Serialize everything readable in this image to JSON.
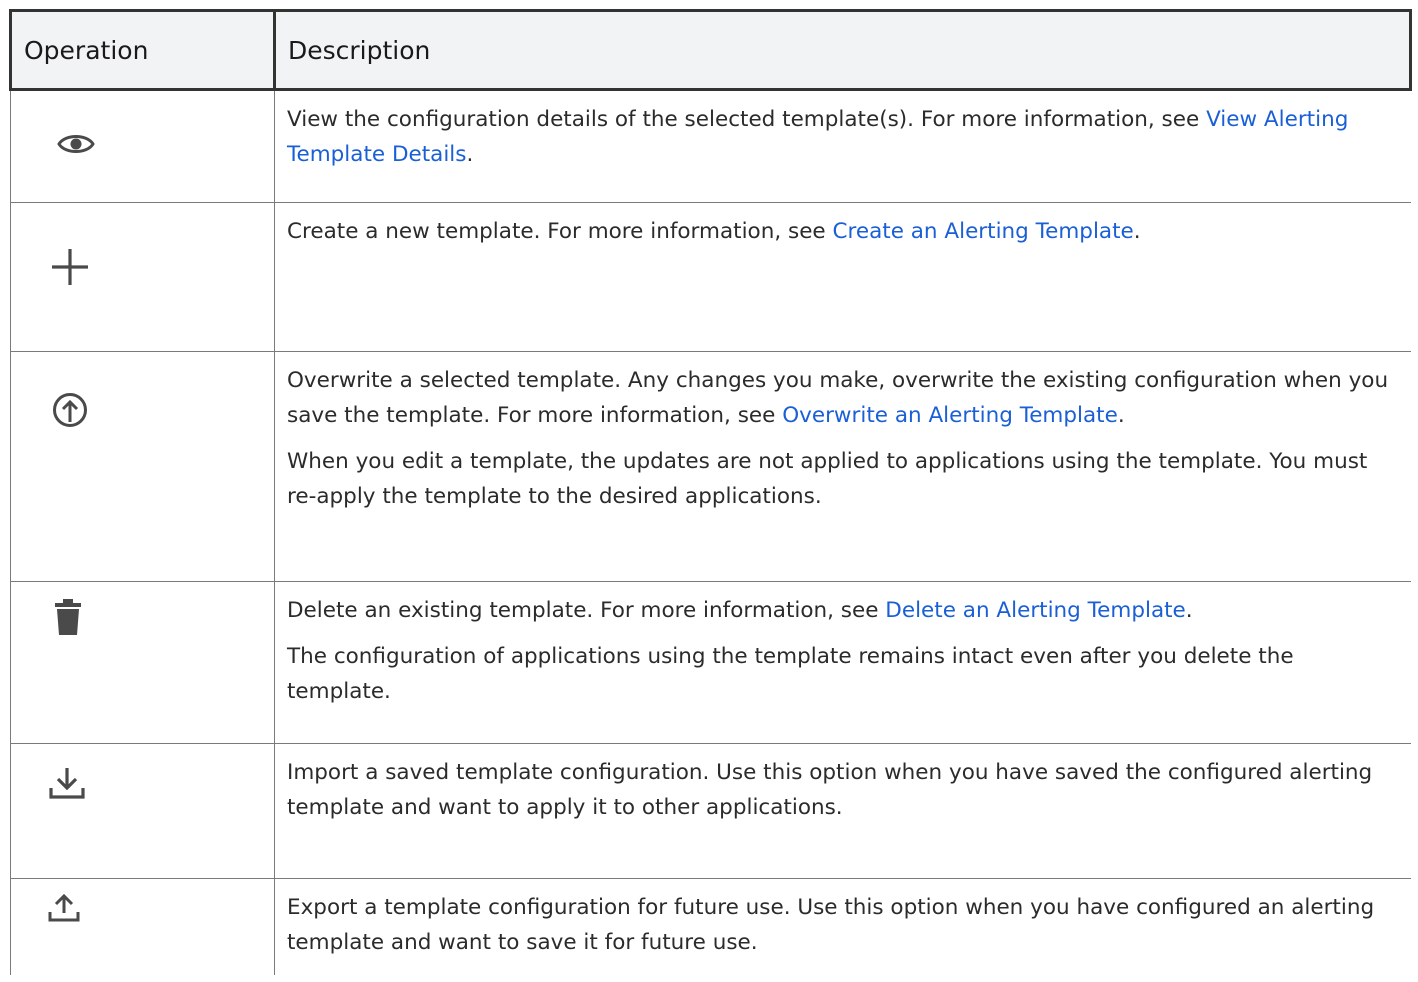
{
  "table": {
    "headers": {
      "operation": "Operation",
      "description": "Description"
    },
    "rows": [
      {
        "icon": "eye-icon",
        "paragraphs": [
          {
            "text": "View the configuration details of the selected template(s). For more information, see ",
            "link": "View Alerting Template Details",
            "after": "."
          }
        ]
      },
      {
        "icon": "plus-icon",
        "paragraphs": [
          {
            "text": "Create a new template. For more information, see ",
            "link": "Create an Alerting Template",
            "after": "."
          }
        ]
      },
      {
        "icon": "upload-circle-icon",
        "paragraphs": [
          {
            "text": "Overwrite a selected template. Any changes you make, overwrite the existing configuration when you save the template. For more information, see ",
            "link": "Overwrite an Alerting Template",
            "after": "."
          },
          {
            "text": "When you edit a template, the updates are not applied to applications using the template. You must re-apply the template to the desired applications."
          }
        ]
      },
      {
        "icon": "trash-icon",
        "paragraphs": [
          {
            "text": "Delete an existing template. For more information, see ",
            "link": "Delete an Alerting Template",
            "after": "."
          },
          {
            "text": "The configuration of applications using the template remains intact even after you delete the template."
          }
        ]
      },
      {
        "icon": "import-icon",
        "paragraphs": [
          {
            "text": "Import a saved template configuration. Use this option when you have saved the configured alerting template and want to apply it to other applications."
          }
        ]
      },
      {
        "icon": "export-icon",
        "paragraphs": [
          {
            "text": "Export a template configuration for future use. Use this option when you have configured an alerting template and want to save it for future use."
          }
        ]
      }
    ]
  },
  "colors": {
    "link": "#1a5fd6",
    "header_bg": "#f2f3f5",
    "icon": "#4a4a4a"
  }
}
